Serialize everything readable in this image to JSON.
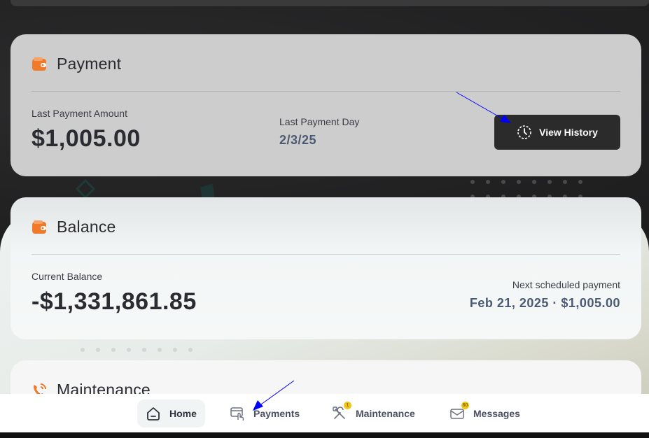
{
  "payment": {
    "title": "Payment",
    "last_amount_label": "Last Payment Amount",
    "last_amount": "$1,005.00",
    "last_day_label": "Last Payment Day",
    "last_day": "2/3/25",
    "history_button": "View History"
  },
  "balance": {
    "title": "Balance",
    "current_label": "Current Balance",
    "current_value": "-$1,331,861.85",
    "next_label": "Next scheduled payment",
    "next_value": "Feb 21, 2025 · $1,005.00"
  },
  "maintenance": {
    "title": "Maintenance"
  },
  "tabbar": {
    "home": "Home",
    "payments": "Payments",
    "maintenance": "Maintenance",
    "maintenance_badge": "1",
    "messages": "Messages",
    "messages_badge": "60"
  },
  "colors": {
    "accent_orange": "#f07a2a",
    "button_dark": "#2b2b2c",
    "badge_yellow": "#f3c613",
    "annotation_arrow": "#0000ff"
  }
}
